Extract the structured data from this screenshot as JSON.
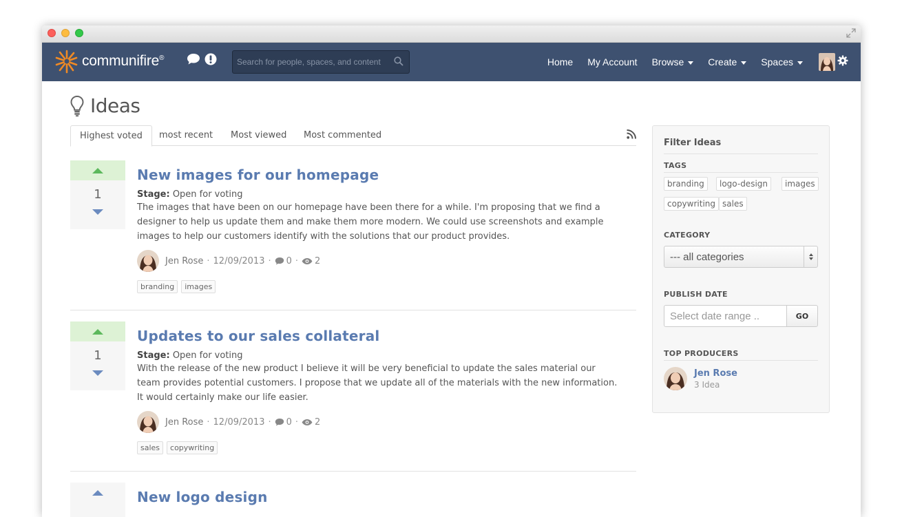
{
  "app": {
    "logo_text": "communifire",
    "logo_mark": "®",
    "search_placeholder": "Search for people, spaces, and content",
    "nav": {
      "home": "Home",
      "my_account": "My Account",
      "browse": "Browse",
      "create": "Create",
      "spaces": "Spaces"
    }
  },
  "page": {
    "title": "Ideas",
    "tabs": [
      "Highest voted",
      "most recent",
      "Most viewed",
      "Most commented"
    ],
    "active_tab": "Highest voted"
  },
  "ideas": [
    {
      "title": "New images for our homepage",
      "votes": "1",
      "stage_label": "Stage:",
      "stage": "Open for voting",
      "description": "The images that have been on our homepage have been there for a while. I'm proposing that we find a designer to help us update them and make them more modern. We could use screenshots and example images to help our customers identify with the solutions that our product provides.",
      "author": "Jen Rose",
      "date": "12/09/2013",
      "comments": "0",
      "views": "2",
      "tags": [
        "branding",
        "images"
      ]
    },
    {
      "title": "Updates to our sales collateral",
      "votes": "1",
      "stage_label": "Stage:",
      "stage": "Open for voting",
      "description": "With the release of the new product I believe it will be very beneficial to update the sales material our team provides potential customers. I propose that we update all of the materials with the new information. It would certainly make our life easier.",
      "author": "Jen Rose",
      "date": "12/09/2013",
      "comments": "0",
      "views": "2",
      "tags": [
        "sales",
        "copywriting"
      ]
    },
    {
      "title": "New logo design"
    }
  ],
  "sidebar": {
    "title": "Filter Ideas",
    "tags_label": "TAGS",
    "tags": [
      "branding",
      "logo-design",
      "images",
      "copywriting",
      "sales"
    ],
    "category_label": "CATEGORY",
    "category_selected": "--- all categories",
    "publish_date_label": "PUBLISH DATE",
    "date_placeholder": "Select date range ..",
    "go_label": "GO",
    "top_producers_label": "TOP PRODUCERS",
    "producer_name": "Jen Rose",
    "producer_count": "3 Idea"
  },
  "colors": {
    "nav_bg": "#3e5170",
    "title_link": "#5a7bb0",
    "upvote_bg": "#ddf2d5",
    "upvote_arrow": "#5cb85c"
  }
}
